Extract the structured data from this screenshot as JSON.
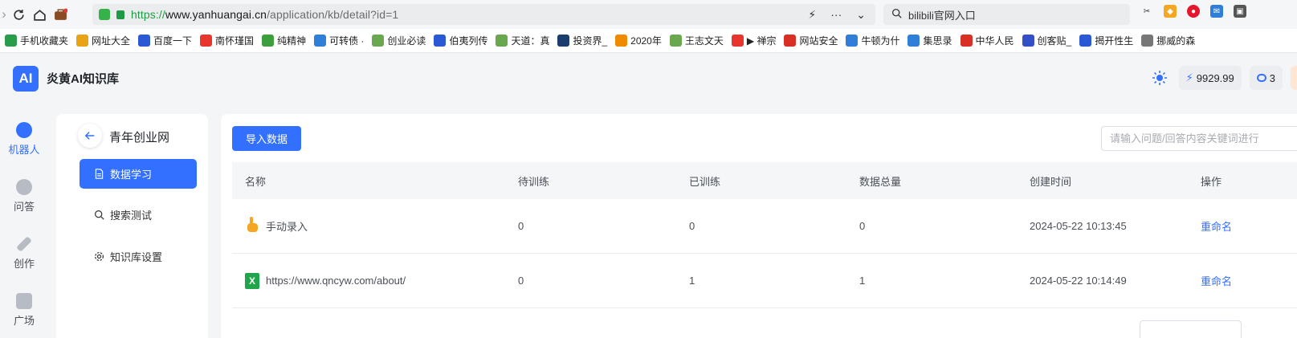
{
  "browser": {
    "url_scheme": "https://",
    "url_host": "www.yanhuangai.cn",
    "url_path": "/application/kb/detail?id=1",
    "search_text": "bilibili官网入口",
    "bookmarks": [
      "手机收藏夹",
      "网址大全",
      "百度一下",
      "南怀瑾国",
      "纯精神",
      "可转债 ·",
      "创业必读",
      "伯夷列传",
      "天道：真",
      "投资界_",
      "2020年",
      "王志文天",
      "▶ 禅宗",
      "网站安全",
      "牛顿为什",
      "集思录",
      "中华人民",
      "创客贴_",
      "揭开性生",
      "挪威的森"
    ],
    "bookmark_colors": [
      "#2a9d4a",
      "#e8a317",
      "#2b59d6",
      "#e8352e",
      "#3c9e3c",
      "#2f7fd9",
      "#6aa84f",
      "#2b59d6",
      "#6aa84f",
      "#1a3c6e",
      "#f08a00",
      "#6aa84f",
      "#e8352e",
      "#d93025",
      "#2f7fd9",
      "#2f7fd9",
      "#d93025",
      "#3350c9",
      "#2b59d6",
      "#777777"
    ]
  },
  "app": {
    "logo_text": "AI",
    "title": "炎黄AI知识库",
    "balance": "9929.99",
    "count": "3"
  },
  "rail": {
    "items": [
      {
        "label": "机器人"
      },
      {
        "label": "问答"
      },
      {
        "label": "创作"
      },
      {
        "label": "广场"
      }
    ]
  },
  "sidebar": {
    "kb_name": "青年创业网",
    "menu": [
      {
        "label": "数据学习"
      },
      {
        "label": "搜索测试"
      },
      {
        "label": "知识库设置"
      }
    ]
  },
  "main": {
    "import_label": "导入数据",
    "search_placeholder": "请输入问题/回答内容关键词进行",
    "columns": [
      "名称",
      "待训练",
      "已训练",
      "数据总量",
      "创建时间",
      "操作"
    ],
    "rows": [
      {
        "name": "手动录入",
        "pending": "0",
        "trained": "0",
        "total": "0",
        "created": "2024-05-22 10:13:45",
        "action": "重命名"
      },
      {
        "name": "https://www.qncyw.com/about/",
        "pending": "0",
        "trained": "1",
        "total": "1",
        "created": "2024-05-22 10:14:49",
        "action": "重命名"
      }
    ]
  },
  "colors": {
    "primary": "#3370ff",
    "excel_green": "#1fa64a",
    "hand_orange": "#f5a623"
  }
}
